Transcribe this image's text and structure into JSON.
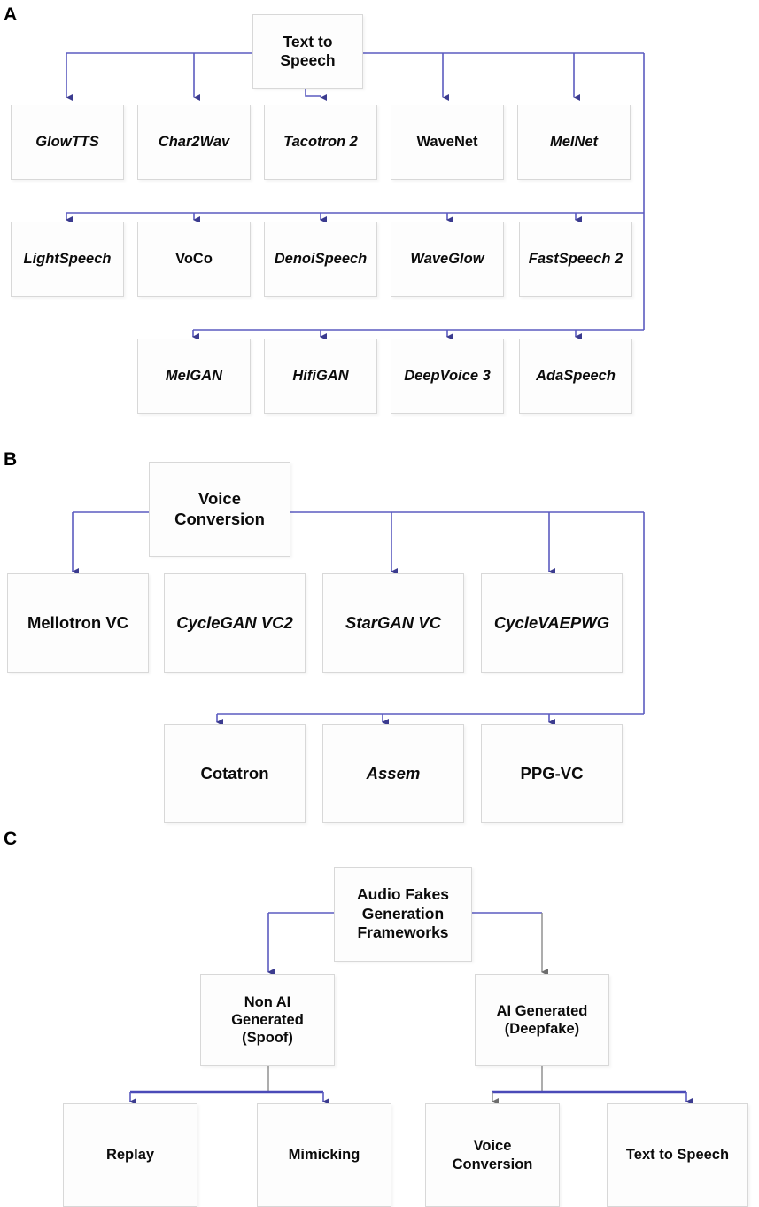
{
  "figure": {
    "panels": [
      {
        "id": "A",
        "label": "A",
        "root": "Text to Speech",
        "rows": [
          [
            "GlowTTS",
            "Char2Wav",
            "Tacotron 2",
            "WaveNet",
            "MelNet"
          ],
          [
            "LightSpeech",
            "VoCo",
            "DenoiSpeech",
            "WaveGlow",
            "FastSpeech 2"
          ],
          [
            "MelGAN",
            "HifiGAN",
            "DeepVoice 3",
            "AdaSpeech"
          ]
        ]
      },
      {
        "id": "B",
        "label": "B",
        "root": "Voice Conversion",
        "rows": [
          [
            "Mellotron VC",
            "CycleGAN VC2",
            "StarGAN VC",
            "CycleVAEPWG"
          ],
          [
            "Cotatron",
            "Assem",
            "PPG-VC"
          ]
        ]
      },
      {
        "id": "C",
        "label": "C",
        "root": "Audio Fakes Generation Frameworks",
        "rows": [
          [
            "Non AI Generated (Spoof)",
            "AI Generated (Deepfake)"
          ],
          [
            "Replay",
            "Mimicking",
            "Voice Conversion",
            "Text to Speech"
          ]
        ]
      }
    ]
  },
  "panelA": {
    "label": "A",
    "root": {
      "line1": "Text to",
      "line2": "Speech"
    },
    "row1": [
      {
        "text": "GlowTTS",
        "style": "italic"
      },
      {
        "text": "Char2Wav",
        "style": "italic"
      },
      {
        "text": "Tacotron 2",
        "style": "italic"
      },
      {
        "text": "WaveNet",
        "style": "roman"
      },
      {
        "text": "MelNet",
        "style": "italic"
      }
    ],
    "row2": [
      {
        "text": "LightSpeech",
        "style": "italic"
      },
      {
        "text": "VoCo",
        "style": "roman"
      },
      {
        "text": "DenoiSpeech",
        "style": "italic"
      },
      {
        "text": "WaveGlow",
        "style": "italic"
      },
      {
        "text": "FastSpeech 2",
        "style": "italic"
      }
    ],
    "row3": [
      {
        "text": "MelGAN",
        "style": "italic"
      },
      {
        "text": "HifiGAN",
        "style": "italic"
      },
      {
        "text": "DeepVoice 3",
        "style": "italic"
      },
      {
        "text": "AdaSpeech",
        "style": "italic"
      }
    ]
  },
  "panelB": {
    "label": "B",
    "root": {
      "line1": "Voice",
      "line2": "Conversion"
    },
    "row1": [
      {
        "text": "Mellotron VC",
        "style": "roman"
      },
      {
        "text": "CycleGAN VC2",
        "style": "italic"
      },
      {
        "text": "StarGAN VC",
        "style": "italic"
      },
      {
        "text": "CycleVAEPWG",
        "style": "italic"
      }
    ],
    "row2": [
      {
        "text": "Cotatron",
        "style": "roman"
      },
      {
        "text": "Assem",
        "style": "italic"
      },
      {
        "text": "PPG-VC",
        "style": "roman"
      }
    ]
  },
  "panelC": {
    "label": "C",
    "root": {
      "line1": "Audio Fakes",
      "line2": "Generation",
      "line3": "Frameworks"
    },
    "row1": [
      {
        "line1": "Non AI",
        "line2": "Generated",
        "line3": "(Spoof)"
      },
      {
        "line1": "AI Generated",
        "line2": "(Deepfake)",
        "line3": ""
      }
    ],
    "row2": [
      {
        "line1": "Replay",
        "line2": ""
      },
      {
        "line1": "Mimicking",
        "line2": ""
      },
      {
        "line1": "Voice",
        "line2": "Conversion"
      },
      {
        "line1": "Text to Speech",
        "line2": ""
      }
    ]
  },
  "colors": {
    "connector_blue": "#5b5bc0",
    "connector_grey": "#8a8a8a",
    "box_border": "#d8d8d8",
    "box_fill": "#fdfdfd",
    "text": "#0b0b0b"
  }
}
